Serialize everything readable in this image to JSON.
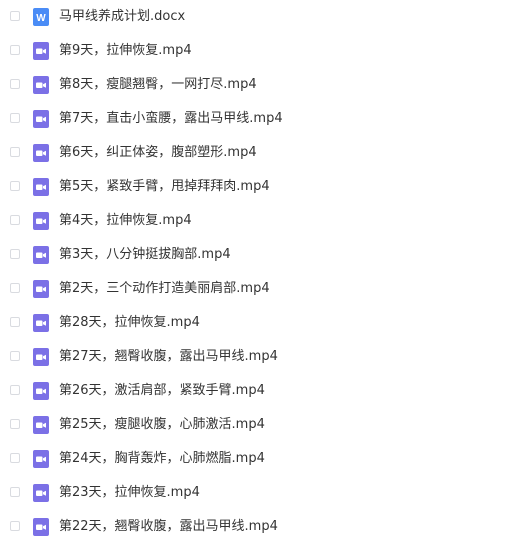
{
  "colors": {
    "word_icon": "#4a8cf6",
    "video_icon": "#7b70e6",
    "text": "#333333",
    "checkbox_border": "#d9dbe0"
  },
  "files": [
    {
      "name": "马甲线养成计划.docx",
      "icon": "word-icon"
    },
    {
      "name": "第9天，拉伸恢复.mp4",
      "icon": "video-icon"
    },
    {
      "name": "第8天，瘦腿翘臀，一网打尽.mp4",
      "icon": "video-icon"
    },
    {
      "name": "第7天，直击小蛮腰，露出马甲线.mp4",
      "icon": "video-icon"
    },
    {
      "name": "第6天，纠正体姿，腹部塑形.mp4",
      "icon": "video-icon"
    },
    {
      "name": "第5天，紧致手臂，甩掉拜拜肉.mp4",
      "icon": "video-icon"
    },
    {
      "name": "第4天，拉伸恢复.mp4",
      "icon": "video-icon"
    },
    {
      "name": "第3天，八分钟挺拔胸部.mp4",
      "icon": "video-icon"
    },
    {
      "name": "第2天，三个动作打造美丽肩部.mp4",
      "icon": "video-icon"
    },
    {
      "name": "第28天，拉伸恢复.mp4",
      "icon": "video-icon"
    },
    {
      "name": "第27天，翘臀收腹，露出马甲线.mp4",
      "icon": "video-icon"
    },
    {
      "name": "第26天，激活肩部，紧致手臂.mp4",
      "icon": "video-icon"
    },
    {
      "name": "第25天，瘦腿收腹，心肺激活.mp4",
      "icon": "video-icon"
    },
    {
      "name": "第24天，胸背轰炸，心肺燃脂.mp4",
      "icon": "video-icon"
    },
    {
      "name": "第23天，拉伸恢复.mp4",
      "icon": "video-icon"
    },
    {
      "name": "第22天，翘臀收腹，露出马甲线.mp4",
      "icon": "video-icon"
    }
  ]
}
